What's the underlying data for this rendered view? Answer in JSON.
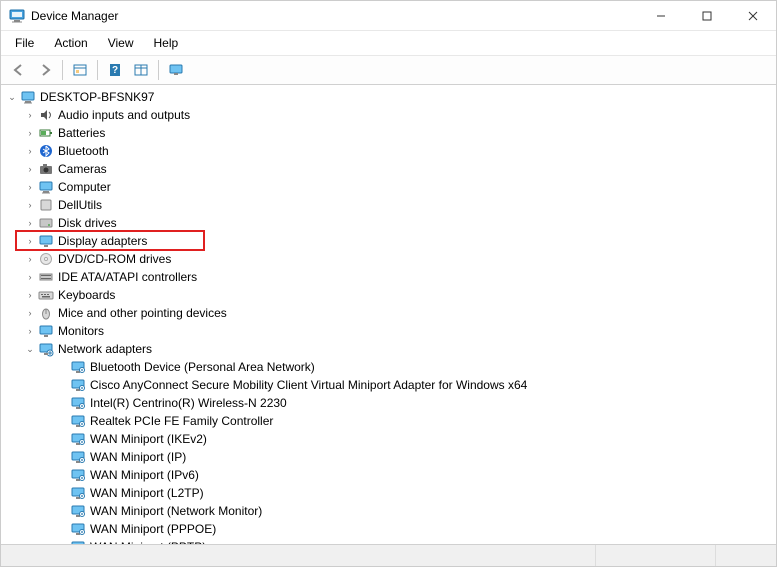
{
  "window": {
    "title": "Device Manager"
  },
  "menu": {
    "file": "File",
    "action": "Action",
    "view": "View",
    "help": "Help"
  },
  "toolbar": {
    "back": "back",
    "forward": "forward",
    "show_hidden": "show-hidden",
    "help": "help",
    "properties": "properties",
    "monitor": "monitor"
  },
  "tree": {
    "root": {
      "label": "DESKTOP-BFSNK97",
      "expanded": true,
      "icon": "computer-icon"
    },
    "categories": [
      {
        "label": "Audio inputs and outputs",
        "icon": "audio-icon",
        "expanded": false
      },
      {
        "label": "Batteries",
        "icon": "battery-icon",
        "expanded": false
      },
      {
        "label": "Bluetooth",
        "icon": "bluetooth-icon",
        "expanded": false
      },
      {
        "label": "Cameras",
        "icon": "camera-icon",
        "expanded": false
      },
      {
        "label": "Computer",
        "icon": "computer-icon",
        "expanded": false
      },
      {
        "label": "DellUtils",
        "icon": "generic-icon",
        "expanded": false
      },
      {
        "label": "Disk drives",
        "icon": "disk-icon",
        "expanded": false
      },
      {
        "label": "Display adapters",
        "icon": "display-icon",
        "expanded": false,
        "highlighted": true
      },
      {
        "label": "DVD/CD-ROM drives",
        "icon": "dvd-icon",
        "expanded": false
      },
      {
        "label": "IDE ATA/ATAPI controllers",
        "icon": "ide-icon",
        "expanded": false
      },
      {
        "label": "Keyboards",
        "icon": "keyboard-icon",
        "expanded": false
      },
      {
        "label": "Mice and other pointing devices",
        "icon": "mouse-icon",
        "expanded": false
      },
      {
        "label": "Monitors",
        "icon": "monitor-icon",
        "expanded": false
      },
      {
        "label": "Network adapters",
        "icon": "network-icon",
        "expanded": true,
        "children": [
          {
            "label": "Bluetooth Device (Personal Area Network)",
            "icon": "net-device-icon"
          },
          {
            "label": "Cisco AnyConnect Secure Mobility Client Virtual Miniport Adapter for Windows x64",
            "icon": "net-device-icon"
          },
          {
            "label": "Intel(R) Centrino(R) Wireless-N 2230",
            "icon": "net-device-icon"
          },
          {
            "label": "Realtek PCIe FE Family Controller",
            "icon": "net-device-icon"
          },
          {
            "label": "WAN Miniport (IKEv2)",
            "icon": "net-device-icon"
          },
          {
            "label": "WAN Miniport (IP)",
            "icon": "net-device-icon"
          },
          {
            "label": "WAN Miniport (IPv6)",
            "icon": "net-device-icon"
          },
          {
            "label": "WAN Miniport (L2TP)",
            "icon": "net-device-icon"
          },
          {
            "label": "WAN Miniport (Network Monitor)",
            "icon": "net-device-icon"
          },
          {
            "label": "WAN Miniport (PPPOE)",
            "icon": "net-device-icon"
          },
          {
            "label": "WAN Miniport (PPTP)",
            "icon": "net-device-icon"
          }
        ]
      }
    ]
  }
}
